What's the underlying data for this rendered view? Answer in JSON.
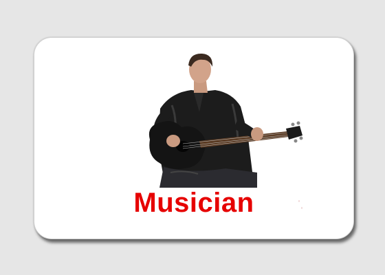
{
  "card": {
    "label": "Musician",
    "label_color": "#e60000",
    "image": "guitarist-photo"
  },
  "colors": {
    "background": "#e6e6e6",
    "card": "#ffffff"
  }
}
